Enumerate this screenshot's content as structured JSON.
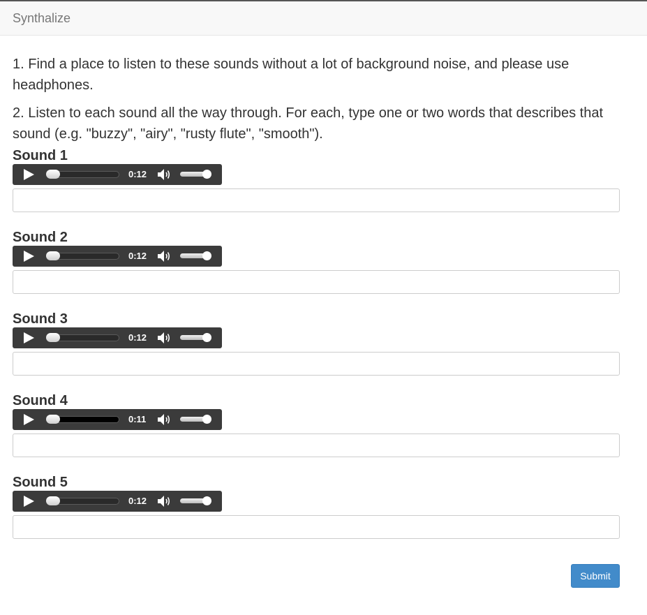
{
  "navbar": {
    "brand": "Synthalize"
  },
  "instructions": [
    "1. Find a place to listen to these sounds without a lot of background noise, and please use headphones.",
    "2. Listen to each sound all the way through. For each, type one or two words that describes that sound (e.g. \"buzzy\", \"airy\", \"rusty flute\", \"smooth\")."
  ],
  "sounds": [
    {
      "title": "Sound 1",
      "time": "0:12",
      "buffered": 0.0,
      "answer": ""
    },
    {
      "title": "Sound 2",
      "time": "0:12",
      "buffered": 0.0,
      "answer": ""
    },
    {
      "title": "Sound 3",
      "time": "0:12",
      "buffered": 0.0,
      "answer": ""
    },
    {
      "title": "Sound 4",
      "time": "0:11",
      "buffered": 1.0,
      "answer": ""
    },
    {
      "title": "Sound 5",
      "time": "0:12",
      "buffered": 0.0,
      "answer": ""
    }
  ],
  "icons": {
    "play": "play-icon",
    "volume": "volume-icon"
  },
  "colors": {
    "player_bg": "#3b3b3b",
    "submit_bg": "#428bca"
  },
  "submit_label": "Submit"
}
